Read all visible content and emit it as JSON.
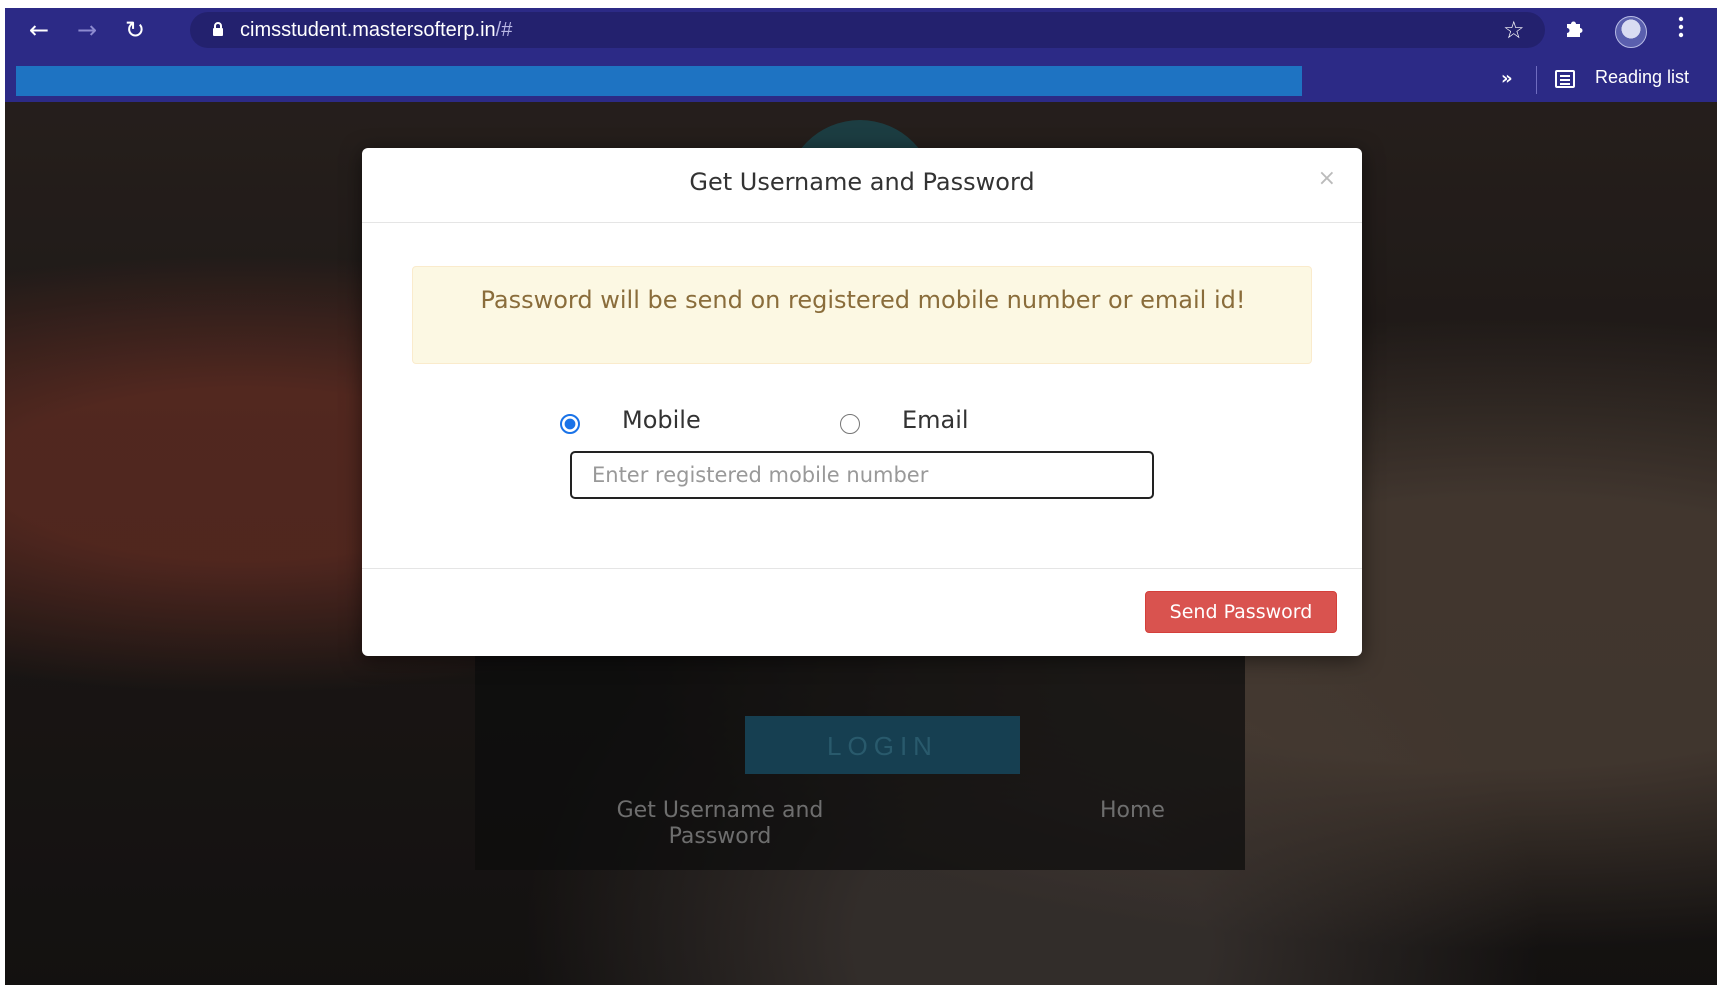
{
  "browser": {
    "url_host": "cimsstudent.mastersofterp.in",
    "url_rest": "/#",
    "reading_list_label": "Reading list",
    "icons": {
      "back": "back-arrow-icon",
      "forward": "forward-arrow-icon",
      "reload": "reload-icon",
      "lock": "lock-icon",
      "star": "star-icon",
      "extensions": "puzzle-icon",
      "menu": "kebab-menu-icon",
      "more_bookmarks": "double-chevron-icon",
      "reading_list": "reading-list-icon"
    },
    "colors": {
      "chrome": "#2c2a86",
      "redacted_bar": "#1e73c2"
    }
  },
  "background_page": {
    "login_button": "LOGIN",
    "get_credentials_link": "Get Username and Password",
    "home_link": "Home"
  },
  "modal": {
    "title": "Get Username and Password",
    "close": "×",
    "alert_text": "Password will be send on registered mobile number or email id!",
    "options": [
      {
        "label": "Mobile",
        "selected": true
      },
      {
        "label": "Email",
        "selected": false
      }
    ],
    "input_placeholder": "Enter registered mobile number",
    "input_value": "",
    "send_button": "Send Password",
    "colors": {
      "send_button": "#d9534f",
      "alert_bg": "#fcf8e3",
      "alert_text": "#8a6d3b",
      "radio_selected": "#1a73e8"
    }
  }
}
